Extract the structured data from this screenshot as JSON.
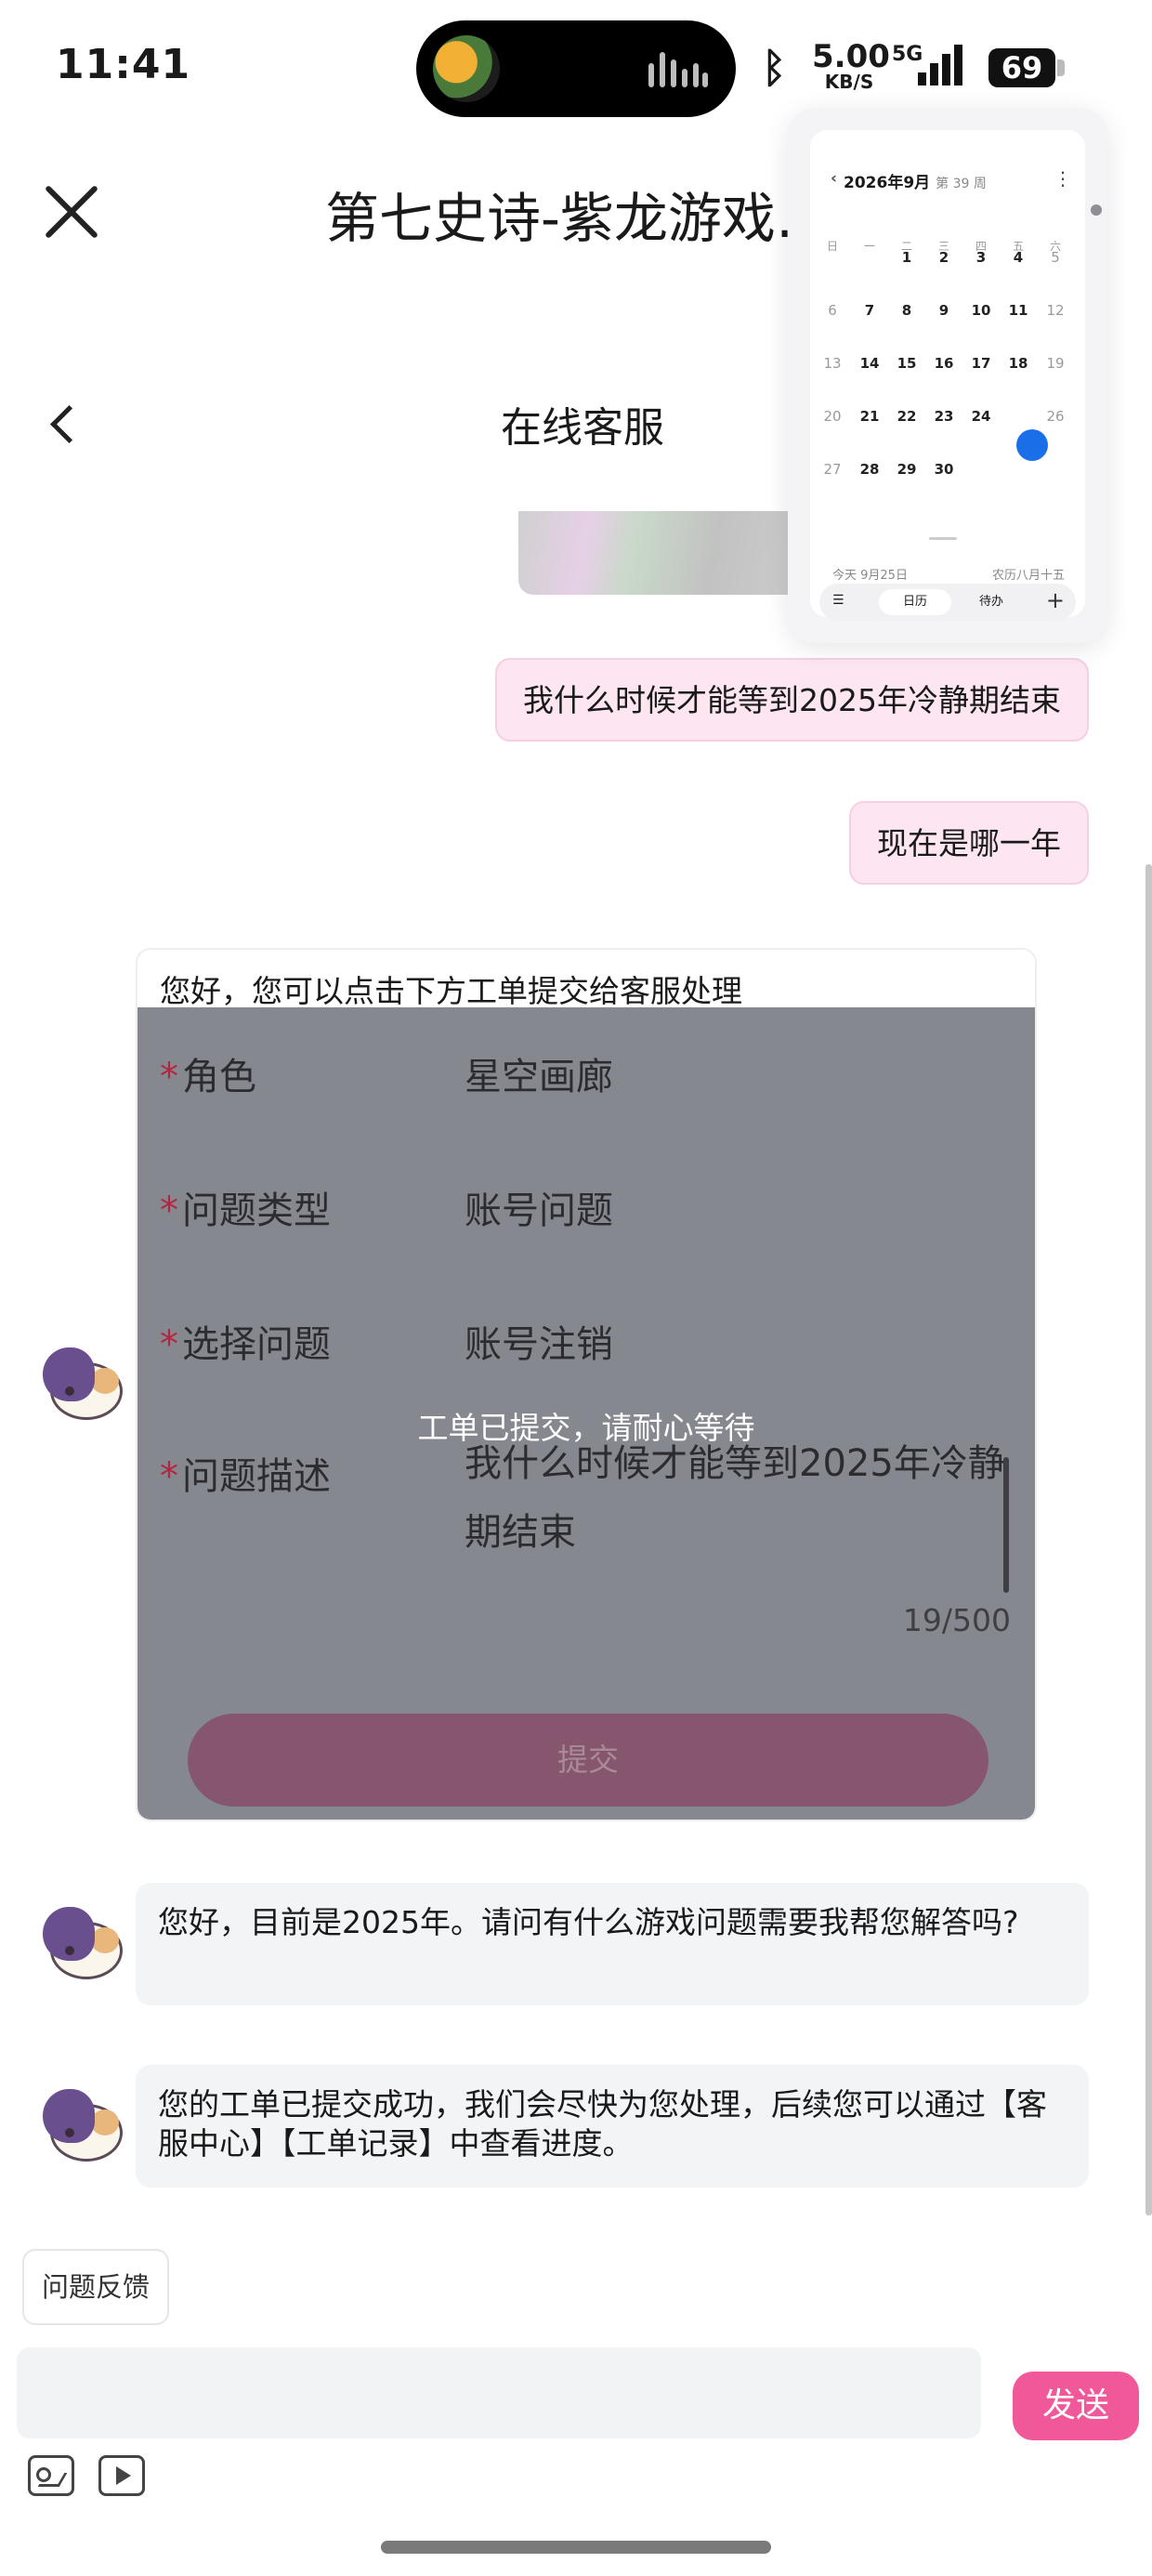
{
  "status_bar": {
    "time": "11:41",
    "net_speed": "5.00",
    "net_unit": "KB/S",
    "network": "5G",
    "battery": "69"
  },
  "header": {
    "app_title": "第七史诗-紫龙游戏…",
    "page_title": "在线客服"
  },
  "chat": {
    "user_messages": [
      "我什么时候才能等到2025年冷静期结束",
      "现在是哪一年"
    ],
    "form": {
      "greeting": "您好，您可以点击下方工单提交给客服处理",
      "fields": [
        {
          "label": "角色",
          "value": "星空画廊",
          "required": "*"
        },
        {
          "label": "问题类型",
          "value": "账号问题",
          "required": "*"
        },
        {
          "label": "选择问题",
          "value": "账号注销",
          "required": "*"
        },
        {
          "label": "问题描述",
          "value": "我什么时候才能等到2025年冷静期结束",
          "required": "*"
        }
      ],
      "char_count": "19/500",
      "submit_label": "提交",
      "toast": "工单已提交，请耐心等待"
    },
    "bot_messages": [
      "您好，目前是2025年。请问有什么游戏问题需要我帮您解答吗?",
      "您的工单已提交成功，我们会尽快为您处理，后续您可以通过【客服中心】【工单记录】中查看进度。"
    ]
  },
  "bottom": {
    "feedback_label": "问题反馈",
    "input_placeholder": "",
    "send_label": "发送",
    "tools": [
      "image-upload-icon",
      "video-upload-icon"
    ]
  },
  "calendar_widget": {
    "month_label": "2026年9月",
    "week_label": "第 39 周",
    "weekdays": [
      "日",
      "一",
      "二",
      "三",
      "四",
      "五",
      "六"
    ],
    "days": [
      "1",
      "2",
      "3",
      "4",
      "5",
      "6",
      "7",
      "8",
      "9",
      "10",
      "11",
      "12",
      "13",
      "14",
      "15",
      "16",
      "17",
      "18",
      "19",
      "20",
      "21",
      "22",
      "23",
      "24",
      "25",
      "26",
      "27",
      "28",
      "29",
      "30"
    ],
    "selected_day": "25",
    "today_label": "今天 9月25日",
    "lunar_label": "农历八月十五",
    "tabs": [
      "日历",
      "待办"
    ]
  },
  "colors": {
    "accent": "#f0589a",
    "user_bubble": "#fde6f1",
    "overlay": "#868890",
    "required": "#b2263f",
    "calendar_selected": "#1a6ee8"
  }
}
